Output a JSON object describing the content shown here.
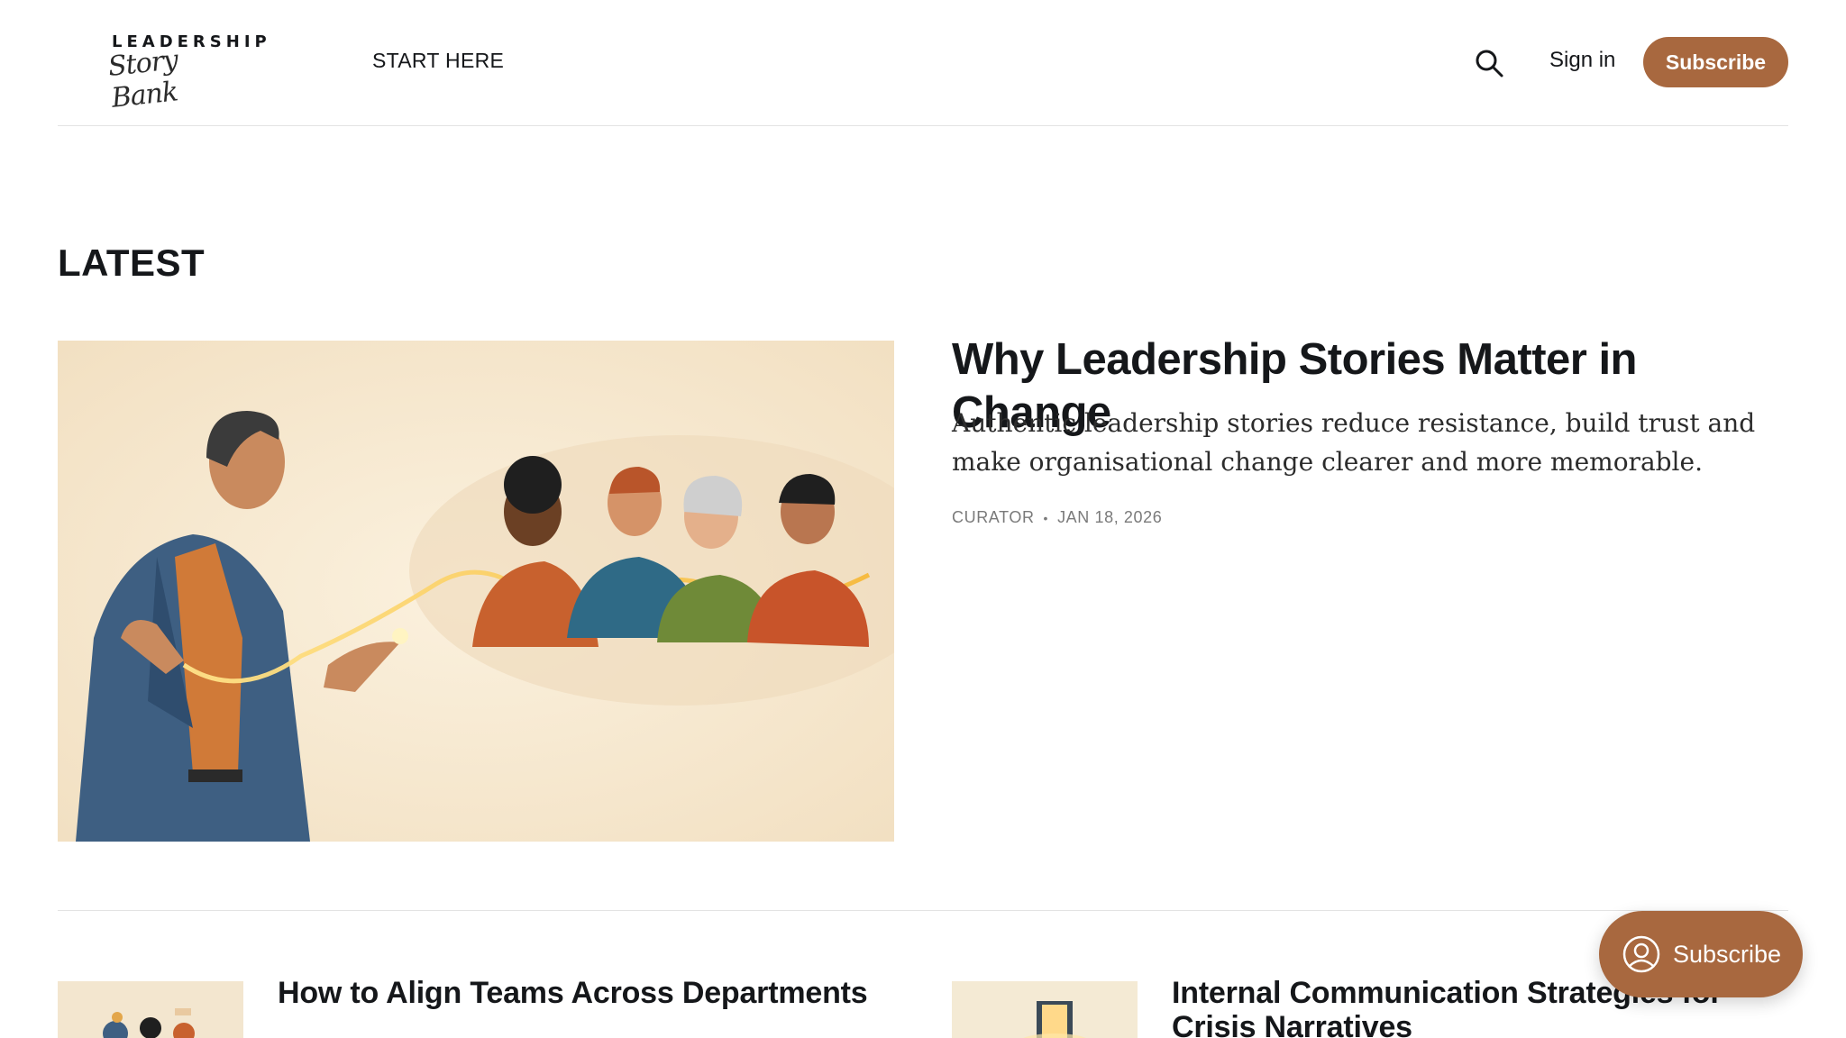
{
  "header": {
    "logo_top": "LEADERSHIP",
    "logo_script": "Story Bank",
    "nav_start": "START HERE",
    "sign_in": "Sign in",
    "subscribe": "Subscribe",
    "search_icon": "search-icon"
  },
  "latest": {
    "title": "LATEST",
    "featured": {
      "title": "Why Leadership Stories Matter in Change",
      "excerpt": "Authentic leadership stories reduce resistance, build trust and make organisational change clearer and more memorable.",
      "author": "CURATOR",
      "separator": "•",
      "date": "JAN 18, 2026"
    },
    "cards": [
      {
        "title": "How to Align Teams Across Departments"
      },
      {
        "title": "Internal Communication Strategies for Crisis Narratives"
      }
    ]
  },
  "floating": {
    "label": "Subscribe",
    "icon": "user-circle-icon"
  },
  "colors": {
    "accent": "#a8683f",
    "text": "#15171a",
    "meta": "#7a7a7a"
  }
}
